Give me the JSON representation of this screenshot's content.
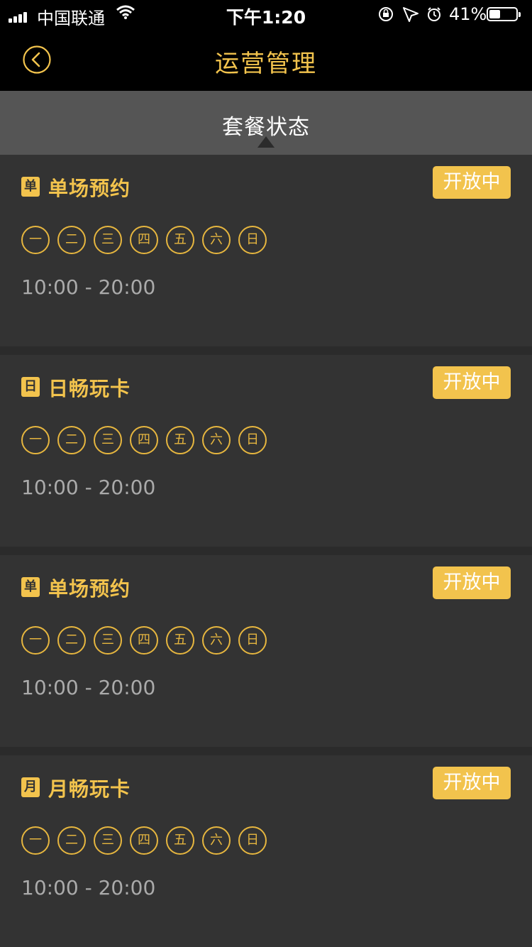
{
  "status_bar": {
    "carrier": "中国联通",
    "time": "下午1:20",
    "battery": "41%"
  },
  "nav": {
    "title": "运营管理"
  },
  "tabs": {
    "active": "套餐状态"
  },
  "colors": {
    "accent": "#f2c34d",
    "background": "#2b2b2b",
    "card": "#333333",
    "nav": "#000000",
    "tab_bar": "#555555"
  },
  "cards": [
    {
      "badge": "单",
      "name": "单场预约",
      "status": "开放中",
      "days": [
        "一",
        "二",
        "三",
        "四",
        "五",
        "六",
        "日"
      ],
      "hours": "10:00 - 20:00"
    },
    {
      "badge": "日",
      "name": "日畅玩卡",
      "status": "开放中",
      "days": [
        "一",
        "二",
        "三",
        "四",
        "五",
        "六",
        "日"
      ],
      "hours": "10:00 - 20:00"
    },
    {
      "badge": "单",
      "name": "单场预约",
      "status": "开放中",
      "days": [
        "一",
        "二",
        "三",
        "四",
        "五",
        "六",
        "日"
      ],
      "hours": "10:00 - 20:00"
    },
    {
      "badge": "月",
      "name": "月畅玩卡",
      "status": "开放中",
      "days": [
        "一",
        "二",
        "三",
        "四",
        "五",
        "六",
        "日"
      ],
      "hours": "10:00 - 20:00"
    }
  ]
}
